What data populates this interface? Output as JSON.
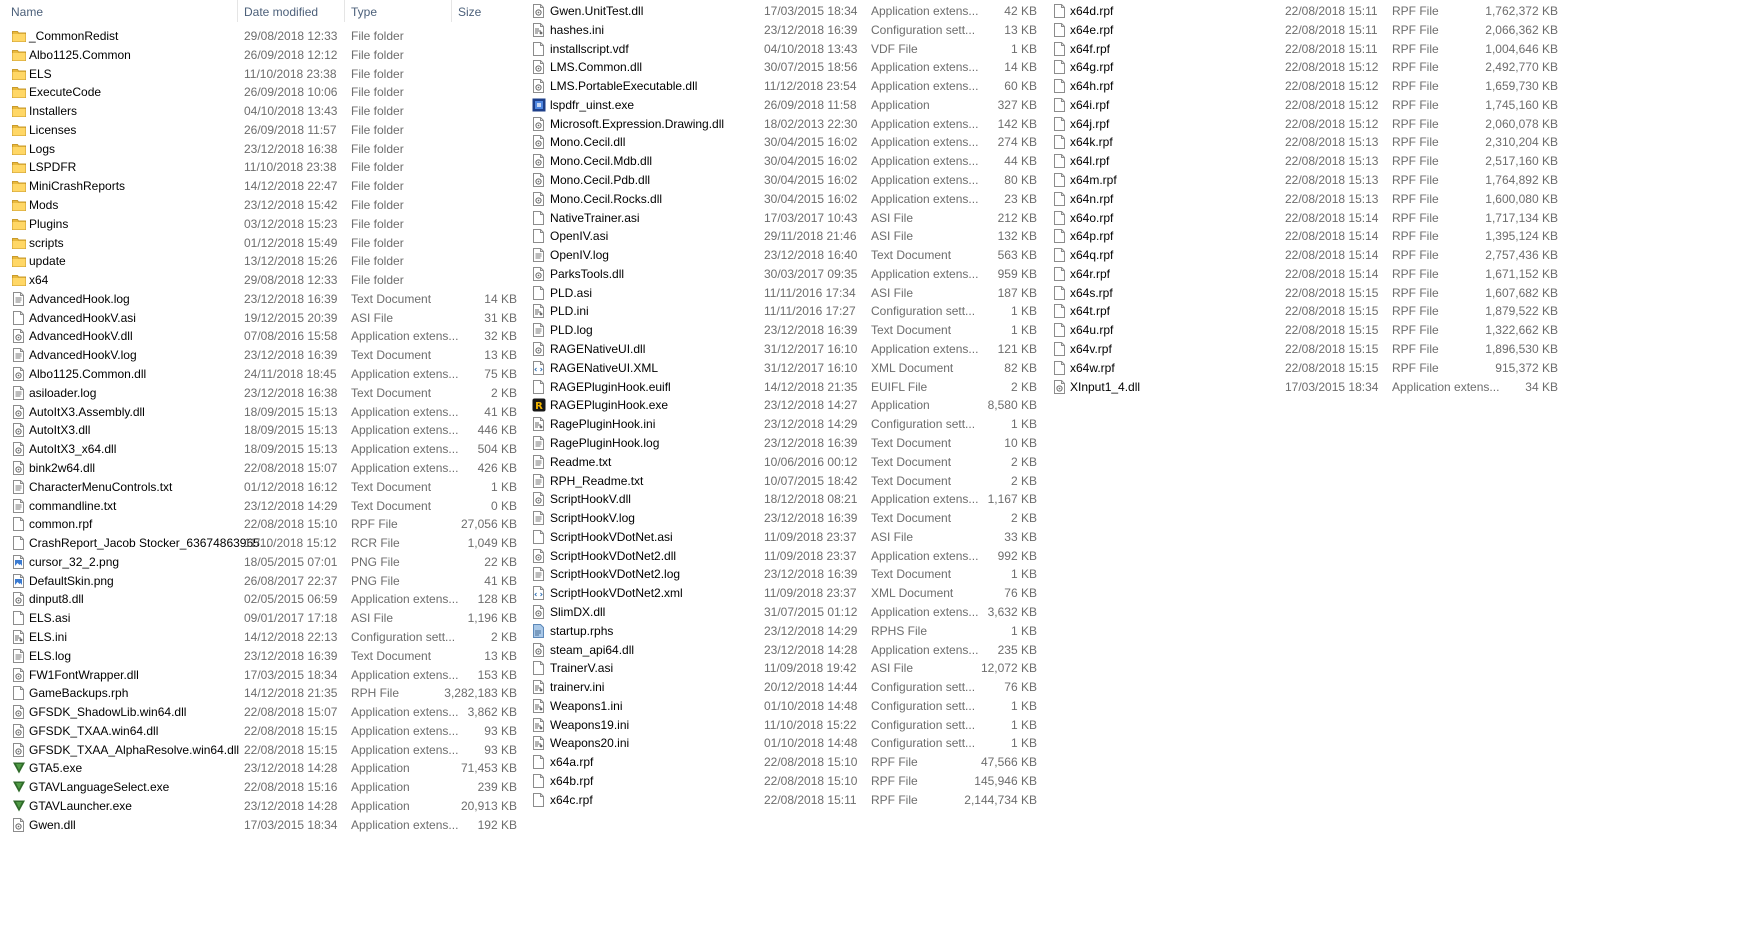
{
  "columns": {
    "name": "Name",
    "date": "Date modified",
    "type": "Type",
    "size": "Size"
  },
  "files": [
    [
      "_CommonRedist",
      "29/08/2018 12:33",
      "File folder",
      "",
      "folder"
    ],
    [
      "Albo1125.Common",
      "26/09/2018 12:12",
      "File folder",
      "",
      "folder"
    ],
    [
      "ELS",
      "11/10/2018 23:38",
      "File folder",
      "",
      "folder"
    ],
    [
      "ExecuteCode",
      "26/09/2018 10:06",
      "File folder",
      "",
      "folder"
    ],
    [
      "Installers",
      "04/10/2018 13:43",
      "File folder",
      "",
      "folder"
    ],
    [
      "Licenses",
      "26/09/2018 11:57",
      "File folder",
      "",
      "folder"
    ],
    [
      "Logs",
      "23/12/2018 16:38",
      "File folder",
      "",
      "folder"
    ],
    [
      "LSPDFR",
      "11/10/2018 23:38",
      "File folder",
      "",
      "folder"
    ],
    [
      "MiniCrashReports",
      "14/12/2018 22:47",
      "File folder",
      "",
      "folder"
    ],
    [
      "Mods",
      "23/12/2018 15:42",
      "File folder",
      "",
      "folder"
    ],
    [
      "Plugins",
      "03/12/2018 15:23",
      "File folder",
      "",
      "folder"
    ],
    [
      "scripts",
      "01/12/2018 15:49",
      "File folder",
      "",
      "folder"
    ],
    [
      "update",
      "13/12/2018 15:26",
      "File folder",
      "",
      "folder"
    ],
    [
      "x64",
      "29/08/2018 12:33",
      "File folder",
      "",
      "folder"
    ],
    [
      "AdvancedHook.log",
      "23/12/2018 16:39",
      "Text Document",
      "14 KB",
      "text"
    ],
    [
      "AdvancedHookV.asi",
      "19/12/2015 20:39",
      "ASI File",
      "31 KB",
      "blank"
    ],
    [
      "AdvancedHookV.dll",
      "07/08/2016 15:58",
      "Application extens...",
      "32 KB",
      "dll"
    ],
    [
      "AdvancedHookV.log",
      "23/12/2018 16:39",
      "Text Document",
      "13 KB",
      "text"
    ],
    [
      "Albo1125.Common.dll",
      "24/11/2018 18:45",
      "Application extens...",
      "75 KB",
      "dll"
    ],
    [
      "asiloader.log",
      "23/12/2018 16:38",
      "Text Document",
      "2 KB",
      "text"
    ],
    [
      "AutoItX3.Assembly.dll",
      "18/09/2015 15:13",
      "Application extens...",
      "41 KB",
      "dll"
    ],
    [
      "AutoItX3.dll",
      "18/09/2015 15:13",
      "Application extens...",
      "446 KB",
      "dll"
    ],
    [
      "AutoItX3_x64.dll",
      "18/09/2015 15:13",
      "Application extens...",
      "504 KB",
      "dll"
    ],
    [
      "bink2w64.dll",
      "22/08/2018 15:07",
      "Application extens...",
      "426 KB",
      "dll"
    ],
    [
      "CharacterMenuControls.txt",
      "01/12/2018 16:12",
      "Text Document",
      "1 KB",
      "text"
    ],
    [
      "commandline.txt",
      "23/12/2018 14:29",
      "Text Document",
      "0 KB",
      "text"
    ],
    [
      "common.rpf",
      "22/08/2018 15:10",
      "RPF File",
      "27,056 KB",
      "blank"
    ],
    [
      "CrashReport_Jacob Stocker_63674863965...",
      "11/10/2018 15:12",
      "RCR File",
      "1,049 KB",
      "blank"
    ],
    [
      "cursor_32_2.png",
      "18/05/2015 07:01",
      "PNG File",
      "22 KB",
      "image"
    ],
    [
      "DefaultSkin.png",
      "26/08/2017 22:37",
      "PNG File",
      "41 KB",
      "image"
    ],
    [
      "dinput8.dll",
      "02/05/2015 06:59",
      "Application extens...",
      "128 KB",
      "dll"
    ],
    [
      "ELS.asi",
      "09/01/2017 17:18",
      "ASI File",
      "1,196 KB",
      "blank"
    ],
    [
      "ELS.ini",
      "14/12/2018 22:13",
      "Configuration sett...",
      "2 KB",
      "config"
    ],
    [
      "ELS.log",
      "23/12/2018 16:39",
      "Text Document",
      "13 KB",
      "text"
    ],
    [
      "FW1FontWrapper.dll",
      "17/03/2015 18:34",
      "Application extens...",
      "153 KB",
      "dll"
    ],
    [
      "GameBackups.rph",
      "14/12/2018 21:35",
      "RPH File",
      "3,282,183 KB",
      "blank"
    ],
    [
      "GFSDK_ShadowLib.win64.dll",
      "22/08/2018 15:07",
      "Application extens...",
      "3,862 KB",
      "dll"
    ],
    [
      "GFSDK_TXAA.win64.dll",
      "22/08/2018 15:15",
      "Application extens...",
      "93 KB",
      "dll"
    ],
    [
      "GFSDK_TXAA_AlphaResolve.win64.dll",
      "22/08/2018 15:15",
      "Application extens...",
      "93 KB",
      "dll"
    ],
    [
      "GTA5.exe",
      "23/12/2018 14:28",
      "Application",
      "71,453 KB",
      "gtav"
    ],
    [
      "GTAVLanguageSelect.exe",
      "22/08/2018 15:16",
      "Application",
      "239 KB",
      "gtav"
    ],
    [
      "GTAVLauncher.exe",
      "23/12/2018 14:28",
      "Application",
      "20,913 KB",
      "gtav"
    ],
    [
      "Gwen.dll",
      "17/03/2015 18:34",
      "Application extens...",
      "192 KB",
      "dll"
    ],
    [
      "Gwen.UnitTest.dll",
      "17/03/2015 18:34",
      "Application extens...",
      "42 KB",
      "dll"
    ],
    [
      "hashes.ini",
      "23/12/2018 16:39",
      "Configuration sett...",
      "13 KB",
      "config"
    ],
    [
      "installscript.vdf",
      "04/10/2018 13:43",
      "VDF File",
      "1 KB",
      "blank"
    ],
    [
      "LMS.Common.dll",
      "30/07/2015 18:56",
      "Application extens...",
      "14 KB",
      "dll"
    ],
    [
      "LMS.PortableExecutable.dll",
      "11/12/2018 23:54",
      "Application extens...",
      "60 KB",
      "dll"
    ],
    [
      "lspdfr_uinst.exe",
      "26/09/2018 11:58",
      "Application",
      "327 KB",
      "uninst"
    ],
    [
      "Microsoft.Expression.Drawing.dll",
      "18/02/2013 22:30",
      "Application extens...",
      "142 KB",
      "dll"
    ],
    [
      "Mono.Cecil.dll",
      "30/04/2015 16:02",
      "Application extens...",
      "274 KB",
      "dll"
    ],
    [
      "Mono.Cecil.Mdb.dll",
      "30/04/2015 16:02",
      "Application extens...",
      "44 KB",
      "dll"
    ],
    [
      "Mono.Cecil.Pdb.dll",
      "30/04/2015 16:02",
      "Application extens...",
      "80 KB",
      "dll"
    ],
    [
      "Mono.Cecil.Rocks.dll",
      "30/04/2015 16:02",
      "Application extens...",
      "23 KB",
      "dll"
    ],
    [
      "NativeTrainer.asi",
      "17/03/2017 10:43",
      "ASI File",
      "212 KB",
      "blank"
    ],
    [
      "OpenIV.asi",
      "29/11/2018 21:46",
      "ASI File",
      "132 KB",
      "blank"
    ],
    [
      "OpenIV.log",
      "23/12/2018 16:40",
      "Text Document",
      "563 KB",
      "text"
    ],
    [
      "ParksTools.dll",
      "30/03/2017 09:35",
      "Application extens...",
      "959 KB",
      "dll"
    ],
    [
      "PLD.asi",
      "11/11/2016 17:34",
      "ASI File",
      "187 KB",
      "blank"
    ],
    [
      "PLD.ini",
      "11/11/2016 17:27",
      "Configuration sett...",
      "1 KB",
      "config"
    ],
    [
      "PLD.log",
      "23/12/2018 16:39",
      "Text Document",
      "1 KB",
      "text"
    ],
    [
      "RAGENativeUI.dll",
      "31/12/2017 16:10",
      "Application extens...",
      "121 KB",
      "dll"
    ],
    [
      "RAGENativeUI.XML",
      "31/12/2017 16:10",
      "XML Document",
      "82 KB",
      "xml"
    ],
    [
      "RAGEPluginHook.euifl",
      "14/12/2018 21:35",
      "EUIFL File",
      "2 KB",
      "blank"
    ],
    [
      "RAGEPluginHook.exe",
      "23/12/2018 14:27",
      "Application",
      "8,580 KB",
      "rph"
    ],
    [
      "RagePluginHook.ini",
      "23/12/2018 14:29",
      "Configuration sett...",
      "1 KB",
      "config"
    ],
    [
      "RagePluginHook.log",
      "23/12/2018 16:39",
      "Text Document",
      "10 KB",
      "text"
    ],
    [
      "Readme.txt",
      "10/06/2016 00:12",
      "Text Document",
      "2 KB",
      "text"
    ],
    [
      "RPH_Readme.txt",
      "10/07/2015 18:42",
      "Text Document",
      "2 KB",
      "text"
    ],
    [
      "ScriptHookV.dll",
      "18/12/2018 08:21",
      "Application extens...",
      "1,167 KB",
      "dll"
    ],
    [
      "ScriptHookV.log",
      "23/12/2018 16:39",
      "Text Document",
      "2 KB",
      "text"
    ],
    [
      "ScriptHookVDotNet.asi",
      "11/09/2018 23:37",
      "ASI File",
      "33 KB",
      "blank"
    ],
    [
      "ScriptHookVDotNet2.dll",
      "11/09/2018 23:37",
      "Application extens...",
      "992 KB",
      "dll"
    ],
    [
      "ScriptHookVDotNet2.log",
      "23/12/2018 16:39",
      "Text Document",
      "1 KB",
      "text"
    ],
    [
      "ScriptHookVDotNet2.xml",
      "11/09/2018 23:37",
      "XML Document",
      "76 KB",
      "xml"
    ],
    [
      "SlimDX.dll",
      "31/07/2015 01:12",
      "Application extens...",
      "3,632 KB",
      "dll"
    ],
    [
      "startup.rphs",
      "23/12/2018 14:29",
      "RPHS File",
      "1 KB",
      "rphs"
    ],
    [
      "steam_api64.dll",
      "23/12/2018 14:28",
      "Application extens...",
      "235 KB",
      "dll"
    ],
    [
      "TrainerV.asi",
      "11/09/2018 19:42",
      "ASI File",
      "12,072 KB",
      "blank"
    ],
    [
      "trainerv.ini",
      "20/12/2018 14:44",
      "Configuration sett...",
      "76 KB",
      "config"
    ],
    [
      "Weapons1.ini",
      "01/10/2018 14:48",
      "Configuration sett...",
      "1 KB",
      "config"
    ],
    [
      "Weapons19.ini",
      "11/10/2018 15:22",
      "Configuration sett...",
      "1 KB",
      "config"
    ],
    [
      "Weapons20.ini",
      "01/10/2018 14:48",
      "Configuration sett...",
      "1 KB",
      "config"
    ],
    [
      "x64a.rpf",
      "22/08/2018 15:10",
      "RPF File",
      "47,566 KB",
      "blank"
    ],
    [
      "x64b.rpf",
      "22/08/2018 15:10",
      "RPF File",
      "145,946 KB",
      "blank"
    ],
    [
      "x64c.rpf",
      "22/08/2018 15:11",
      "RPF File",
      "2,144,734 KB",
      "blank"
    ],
    [
      "x64d.rpf",
      "22/08/2018 15:11",
      "RPF File",
      "1,762,372 KB",
      "blank"
    ],
    [
      "x64e.rpf",
      "22/08/2018 15:11",
      "RPF File",
      "2,066,362 KB",
      "blank"
    ],
    [
      "x64f.rpf",
      "22/08/2018 15:11",
      "RPF File",
      "1,004,646 KB",
      "blank"
    ],
    [
      "x64g.rpf",
      "22/08/2018 15:12",
      "RPF File",
      "2,492,770 KB",
      "blank"
    ],
    [
      "x64h.rpf",
      "22/08/2018 15:12",
      "RPF File",
      "1,659,730 KB",
      "blank"
    ],
    [
      "x64i.rpf",
      "22/08/2018 15:12",
      "RPF File",
      "1,745,160 KB",
      "blank"
    ],
    [
      "x64j.rpf",
      "22/08/2018 15:12",
      "RPF File",
      "2,060,078 KB",
      "blank"
    ],
    [
      "x64k.rpf",
      "22/08/2018 15:13",
      "RPF File",
      "2,310,204 KB",
      "blank"
    ],
    [
      "x64l.rpf",
      "22/08/2018 15:13",
      "RPF File",
      "2,517,160 KB",
      "blank"
    ],
    [
      "x64m.rpf",
      "22/08/2018 15:13",
      "RPF File",
      "1,764,892 KB",
      "blank"
    ],
    [
      "x64n.rpf",
      "22/08/2018 15:13",
      "RPF File",
      "1,600,080 KB",
      "blank"
    ],
    [
      "x64o.rpf",
      "22/08/2018 15:14",
      "RPF File",
      "1,717,134 KB",
      "blank"
    ],
    [
      "x64p.rpf",
      "22/08/2018 15:14",
      "RPF File",
      "1,395,124 KB",
      "blank"
    ],
    [
      "x64q.rpf",
      "22/08/2018 15:14",
      "RPF File",
      "2,757,436 KB",
      "blank"
    ],
    [
      "x64r.rpf",
      "22/08/2018 15:14",
      "RPF File",
      "1,671,152 KB",
      "blank"
    ],
    [
      "x64s.rpf",
      "22/08/2018 15:15",
      "RPF File",
      "1,607,682 KB",
      "blank"
    ],
    [
      "x64t.rpf",
      "22/08/2018 15:15",
      "RPF File",
      "1,879,522 KB",
      "blank"
    ],
    [
      "x64u.rpf",
      "22/08/2018 15:15",
      "RPF File",
      "1,322,662 KB",
      "blank"
    ],
    [
      "x64v.rpf",
      "22/08/2018 15:15",
      "RPF File",
      "1,896,530 KB",
      "blank"
    ],
    [
      "x64w.rpf",
      "22/08/2018 15:15",
      "RPF File",
      "915,372 KB",
      "blank"
    ],
    [
      "XInput1_4.dll",
      "17/03/2015 18:34",
      "Application extens...",
      "34 KB",
      "dll"
    ]
  ]
}
